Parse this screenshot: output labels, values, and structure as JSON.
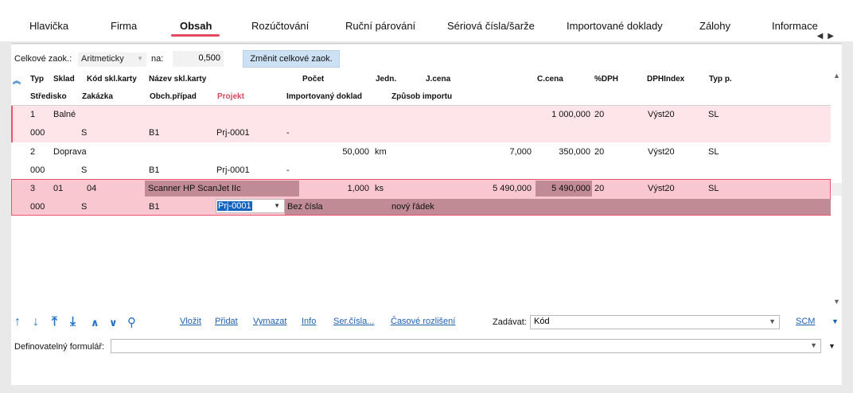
{
  "tabs": [
    {
      "label": "Hlavička",
      "active": false
    },
    {
      "label": "Firma",
      "active": false
    },
    {
      "label": "Obsah",
      "active": true
    },
    {
      "label": "Rozúčtování",
      "active": false
    },
    {
      "label": "Ruční párování",
      "active": false
    },
    {
      "label": "Sériová čísla/šarže",
      "active": false
    },
    {
      "label": "Importované doklady",
      "active": false
    },
    {
      "label": "Zálohy",
      "active": false
    },
    {
      "label": "Informace",
      "active": false
    }
  ],
  "rounding": {
    "label": "Celkové zaok.:",
    "method": "Aritmeticky",
    "on_label": "na:",
    "value": "0,500",
    "button": "Změnit celkové zaok."
  },
  "columns_top": [
    "Typ",
    "Sklad",
    "Kód skl.karty",
    "Název skl.karty",
    "Počet",
    "Jedn.",
    "J.cena",
    "C.cena",
    "%DPH",
    "DPHIndex",
    "Typ p."
  ],
  "columns_bottom": [
    "Středisko",
    "Zakázka",
    "Obch.případ",
    "Projekt",
    "Importovaný doklad",
    "Způsob importu"
  ],
  "rows": [
    {
      "typ": "1",
      "sklad": "Balné",
      "kod": "",
      "nazev": "",
      "pocet": "",
      "jedn": "",
      "jcena": "",
      "ccena": "1 000,000",
      "dph": "20",
      "dphindex": "Výst20",
      "typp": "SL",
      "stredisko": "000",
      "zakazka": "S",
      "obch": "B1",
      "projekt": "Prj-0001",
      "import_doklad": "-",
      "zpusob": ""
    },
    {
      "typ": "2",
      "sklad": "Doprava",
      "kod": "",
      "nazev": "",
      "pocet": "50,000",
      "jedn": "km",
      "jcena": "7,000",
      "ccena": "350,000",
      "dph": "20",
      "dphindex": "Výst20",
      "typp": "SL",
      "stredisko": "000",
      "zakazka": "S",
      "obch": "B1",
      "projekt": "Prj-0001",
      "import_doklad": "-",
      "zpusob": ""
    },
    {
      "typ": "3",
      "sklad": "01",
      "kod": "04",
      "nazev": "Scanner HP ScanJet IIc",
      "pocet": "1,000",
      "jedn": "ks",
      "jcena": "5 490,000",
      "ccena": "5 490,000",
      "dph": "20",
      "dphindex": "Výst20",
      "typp": "SL",
      "stredisko": "000",
      "zakazka": "S",
      "obch": "B1",
      "projekt": "Prj-0001",
      "import_doklad": "Bez čísla",
      "zpusob": "nový řádek"
    }
  ],
  "toolbar": {
    "vlozit": "Vložit",
    "pridat": "Přidat",
    "vymazat": "Vymazat",
    "info": "Info",
    "ser": "Ser.čísla...",
    "casove": "Časové rozlišení",
    "zadavat_label": "Zadávat:",
    "zadavat_value": "Kód",
    "scm": "SCM"
  },
  "form": {
    "label": "Definovatelný formulář:",
    "value": ""
  },
  "colors": {
    "accent": "#e14b60",
    "link": "#1f5fb0",
    "row_pink": "#fde5e9",
    "row_selected": "#f8c7d0"
  }
}
